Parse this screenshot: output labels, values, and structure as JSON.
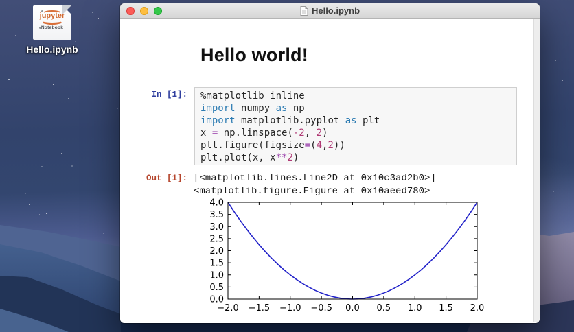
{
  "desktop": {
    "icon": {
      "label": "Hello.ipynb",
      "logo_text": "jupyter",
      "logo_subtext": "Notebook"
    }
  },
  "window": {
    "title": "Hello.ipynb",
    "traffic_lights": {
      "close": "#fc5b57",
      "minimize": "#fdbe41",
      "zoom": "#34c84a"
    }
  },
  "notebook": {
    "heading": "Hello world!",
    "cells": [
      {
        "type": "code",
        "in_prompt": "In [1]:",
        "out_prompt": "Out [1]:",
        "code_lines": [
          [
            [
              "%matplotlib inline",
              "d"
            ]
          ],
          [
            [
              "import",
              "k"
            ],
            [
              " numpy ",
              "d"
            ],
            [
              "as",
              "k"
            ],
            [
              " np",
              "d"
            ]
          ],
          [
            [
              "import",
              "k"
            ],
            [
              " matplotlib.pyplot ",
              "d"
            ],
            [
              "as",
              "k"
            ],
            [
              " plt",
              "d"
            ]
          ],
          [
            [
              "x ",
              "d"
            ],
            [
              "=",
              "o"
            ],
            [
              " np.linspace(",
              "d"
            ],
            [
              "-2",
              "n"
            ],
            [
              ", ",
              "d"
            ],
            [
              "2",
              "n"
            ],
            [
              ")",
              "d"
            ]
          ],
          [
            [
              "plt.figure(figsize",
              "d"
            ],
            [
              "=",
              "o"
            ],
            [
              "(",
              "d"
            ],
            [
              "4",
              "n"
            ],
            [
              ",",
              "d"
            ],
            [
              "2",
              "n"
            ],
            [
              "))",
              "d"
            ]
          ],
          [
            [
              "plt.plot(x, x",
              "d"
            ],
            [
              "**",
              "o"
            ],
            [
              "2",
              "n"
            ],
            [
              ")",
              "d"
            ]
          ]
        ],
        "output_lines": [
          "[<matplotlib.lines.Line2D at 0x10c3ad2b0>]",
          "<matplotlib.figure.Figure at 0x10aeed780>"
        ]
      }
    ]
  },
  "colors": {
    "keyword": "#2c7bb2",
    "number": "#b03a75",
    "operator": "#9638a8",
    "in_prompt": "#303f9f",
    "out_prompt": "#b5452c",
    "plot_line": "#2323c9"
  },
  "chart_data": {
    "type": "line",
    "title": "",
    "xlabel": "",
    "ylabel": "",
    "xlim": [
      -2.0,
      2.0
    ],
    "ylim": [
      0.0,
      4.0
    ],
    "xticks": [
      -2.0,
      -1.5,
      -1.0,
      -0.5,
      0.0,
      0.5,
      1.0,
      1.5,
      2.0
    ],
    "yticks": [
      0.0,
      0.5,
      1.0,
      1.5,
      2.0,
      2.5,
      3.0,
      3.5,
      4.0
    ],
    "grid": false,
    "legend_position": "none",
    "series": [
      {
        "name": "x**2",
        "color": "#2323c9",
        "x": [
          -2.0,
          -1.9,
          -1.8,
          -1.7,
          -1.6,
          -1.5,
          -1.4,
          -1.3,
          -1.2,
          -1.1,
          -1.0,
          -0.9,
          -0.8,
          -0.7,
          -0.6,
          -0.5,
          -0.4,
          -0.3,
          -0.2,
          -0.1,
          0.0,
          0.1,
          0.2,
          0.3,
          0.4,
          0.5,
          0.6,
          0.7,
          0.8,
          0.9,
          1.0,
          1.1,
          1.2,
          1.3,
          1.4,
          1.5,
          1.6,
          1.7,
          1.8,
          1.9,
          2.0
        ],
        "y": [
          4.0,
          3.61,
          3.24,
          2.89,
          2.56,
          2.25,
          1.96,
          1.69,
          1.44,
          1.21,
          1.0,
          0.81,
          0.64,
          0.49,
          0.36,
          0.25,
          0.16,
          0.09,
          0.04,
          0.01,
          0.0,
          0.01,
          0.04,
          0.09,
          0.16,
          0.25,
          0.36,
          0.49,
          0.64,
          0.81,
          1.0,
          1.21,
          1.44,
          1.69,
          1.96,
          2.25,
          2.56,
          2.89,
          3.24,
          3.61,
          4.0
        ]
      }
    ]
  }
}
